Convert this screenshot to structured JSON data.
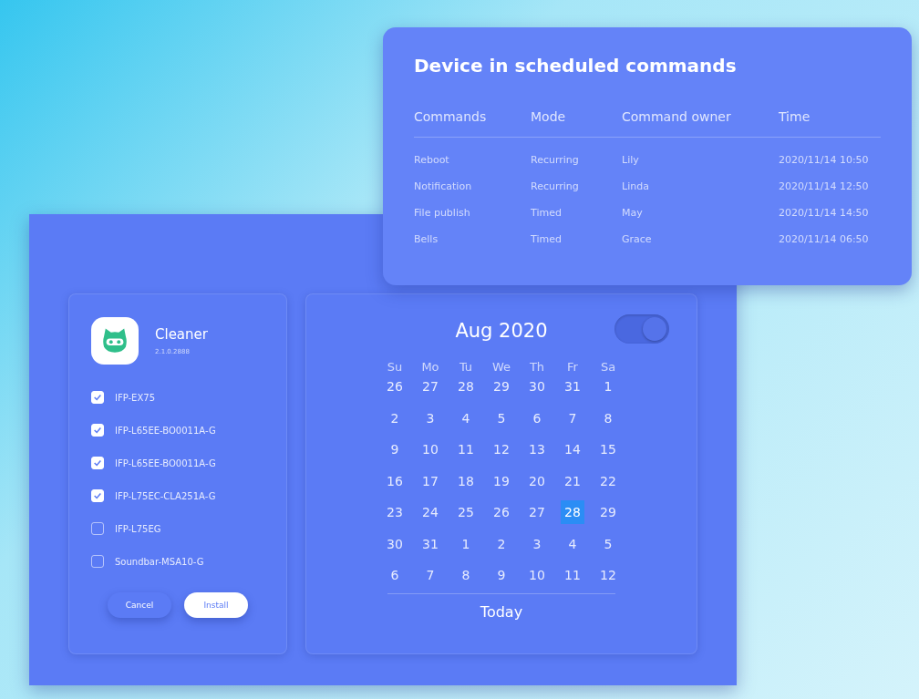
{
  "commands_card": {
    "title": "Device in scheduled commands",
    "columns": [
      "Commands",
      "Mode",
      "Command owner",
      "Time"
    ],
    "rows": [
      [
        "Reboot",
        "Recurring",
        "Lily",
        "2020/11/14 10:50"
      ],
      [
        "Notification",
        "Recurring",
        "Linda",
        "2020/11/14 12:50"
      ],
      [
        "File publish",
        "Timed",
        "May",
        "2020/11/14 14:50"
      ],
      [
        "Bells",
        "Timed",
        "Grace",
        "2020/11/14 06:50"
      ]
    ]
  },
  "install_card": {
    "app_name": "Cleaner",
    "version": "2.1.0.2888",
    "devices": [
      {
        "label": "IFP-EX75",
        "checked": true
      },
      {
        "label": "IFP-L65EE-BO0011A-G",
        "checked": true
      },
      {
        "label": "IFP-L65EE-BO0011A-G",
        "checked": true
      },
      {
        "label": "IFP-L75EC-CLA251A-G",
        "checked": true
      },
      {
        "label": "IFP-L75EG",
        "checked": false
      },
      {
        "label": "Soundbar-MSA10-G",
        "checked": false
      }
    ],
    "buttons": [
      {
        "label": "Cancel",
        "kind": "secondary"
      },
      {
        "label": "Install",
        "kind": "primary"
      }
    ]
  },
  "calendar": {
    "title": "Aug 2020",
    "toggle": {
      "on": true
    },
    "weekdays": [
      "Su",
      "Mo",
      "Tu",
      "We",
      "Th",
      "Fr",
      "Sa"
    ],
    "weeks": [
      [
        {
          "label": "26",
          "selected": false
        },
        {
          "label": "27",
          "selected": false
        },
        {
          "label": "28",
          "selected": false
        },
        {
          "label": "29",
          "selected": false
        },
        {
          "label": "30",
          "selected": false
        },
        {
          "label": "31",
          "selected": false
        },
        {
          "label": "1",
          "selected": false
        }
      ],
      [
        {
          "label": "2",
          "selected": false
        },
        {
          "label": "3",
          "selected": false
        },
        {
          "label": "4",
          "selected": false
        },
        {
          "label": "5",
          "selected": false
        },
        {
          "label": "6",
          "selected": false
        },
        {
          "label": "7",
          "selected": false
        },
        {
          "label": "8",
          "selected": false
        }
      ],
      [
        {
          "label": "9",
          "selected": false
        },
        {
          "label": "10",
          "selected": false
        },
        {
          "label": "11",
          "selected": false
        },
        {
          "label": "12",
          "selected": false
        },
        {
          "label": "13",
          "selected": false
        },
        {
          "label": "14",
          "selected": false
        },
        {
          "label": "15",
          "selected": false
        }
      ],
      [
        {
          "label": "16",
          "selected": false
        },
        {
          "label": "17",
          "selected": false
        },
        {
          "label": "18",
          "selected": false
        },
        {
          "label": "19",
          "selected": false
        },
        {
          "label": "20",
          "selected": false
        },
        {
          "label": "21",
          "selected": false
        },
        {
          "label": "22",
          "selected": false
        }
      ],
      [
        {
          "label": "23",
          "selected": false
        },
        {
          "label": "24",
          "selected": false
        },
        {
          "label": "25",
          "selected": false
        },
        {
          "label": "26",
          "selected": false
        },
        {
          "label": "27",
          "selected": false
        },
        {
          "label": "28",
          "selected": true
        },
        {
          "label": "29",
          "selected": false
        }
      ],
      [
        {
          "label": "30",
          "selected": false
        },
        {
          "label": "31",
          "selected": false
        },
        {
          "label": "1",
          "selected": false
        },
        {
          "label": "2",
          "selected": false
        },
        {
          "label": "3",
          "selected": false
        },
        {
          "label": "4",
          "selected": false
        },
        {
          "label": "5",
          "selected": false
        }
      ],
      [
        {
          "label": "6",
          "selected": false
        },
        {
          "label": "7",
          "selected": false
        },
        {
          "label": "8",
          "selected": false
        },
        {
          "label": "9",
          "selected": false
        },
        {
          "label": "10",
          "selected": false
        },
        {
          "label": "11",
          "selected": false
        },
        {
          "label": "12",
          "selected": false
        }
      ]
    ],
    "today_label": "Today"
  }
}
